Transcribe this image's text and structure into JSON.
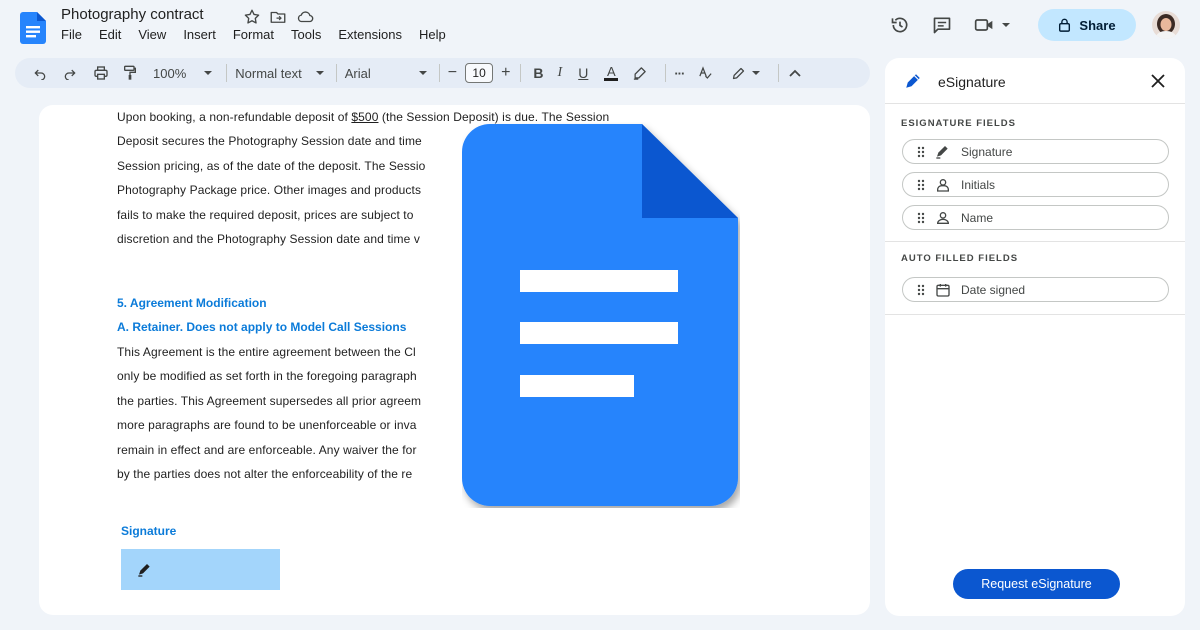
{
  "app": {
    "title": "Photography contract",
    "menu": [
      "File",
      "Edit",
      "View",
      "Insert",
      "Format",
      "Tools",
      "Extensions",
      "Help"
    ],
    "share_label": "Share"
  },
  "toolbar": {
    "zoom": "100%",
    "style": "Normal text",
    "font": "Arial",
    "font_size": "10",
    "minus": "−",
    "plus": "+",
    "bold": "B",
    "italic": "I",
    "underline": "U",
    "text_color": "A",
    "more": "···"
  },
  "document": {
    "para1": [
      "Upon booking, a non-refundable deposit of $500 (the Session Deposit) is due. The Session",
      "Deposit secures the Photography Session date and time",
      "Session pricing, as of the date of the deposit. The Sessio",
      "Photography Package price. Other images and products",
      "fails to make the required deposit, prices are subject to",
      "discretion and the Photography Session date and time v"
    ],
    "heading1": "5. Agreement Modification",
    "heading2": "A. Retainer.  Does not apply to Model Call Sessions",
    "para2": [
      "This Agreement is the entire agreement between the Cl",
      "only be modified as set forth in the foregoing paragraph",
      "the parties.  This Agreement supersedes all prior agreem",
      "more paragraphs are found to be unenforceable or inva",
      "remain in effect and are enforceable. Any waiver the for",
      "by the parties does not alter the enforceability of the re"
    ],
    "signature_label": "Signature"
  },
  "side_panel": {
    "title": "eSignature",
    "esig_section": "ESIGNATURE FIELDS",
    "esig_fields": [
      "Signature",
      "Initials",
      "Name"
    ],
    "auto_section": "AUTO FILLED FIELDS",
    "auto_fields": [
      "Date signed"
    ],
    "request_button": "Request eSignature"
  },
  "colors": {
    "docs_blue": "#2684fc",
    "accent_link": "#0b7bd9",
    "share_bg": "#c2e7ff",
    "primary_button": "#0b57d0"
  }
}
